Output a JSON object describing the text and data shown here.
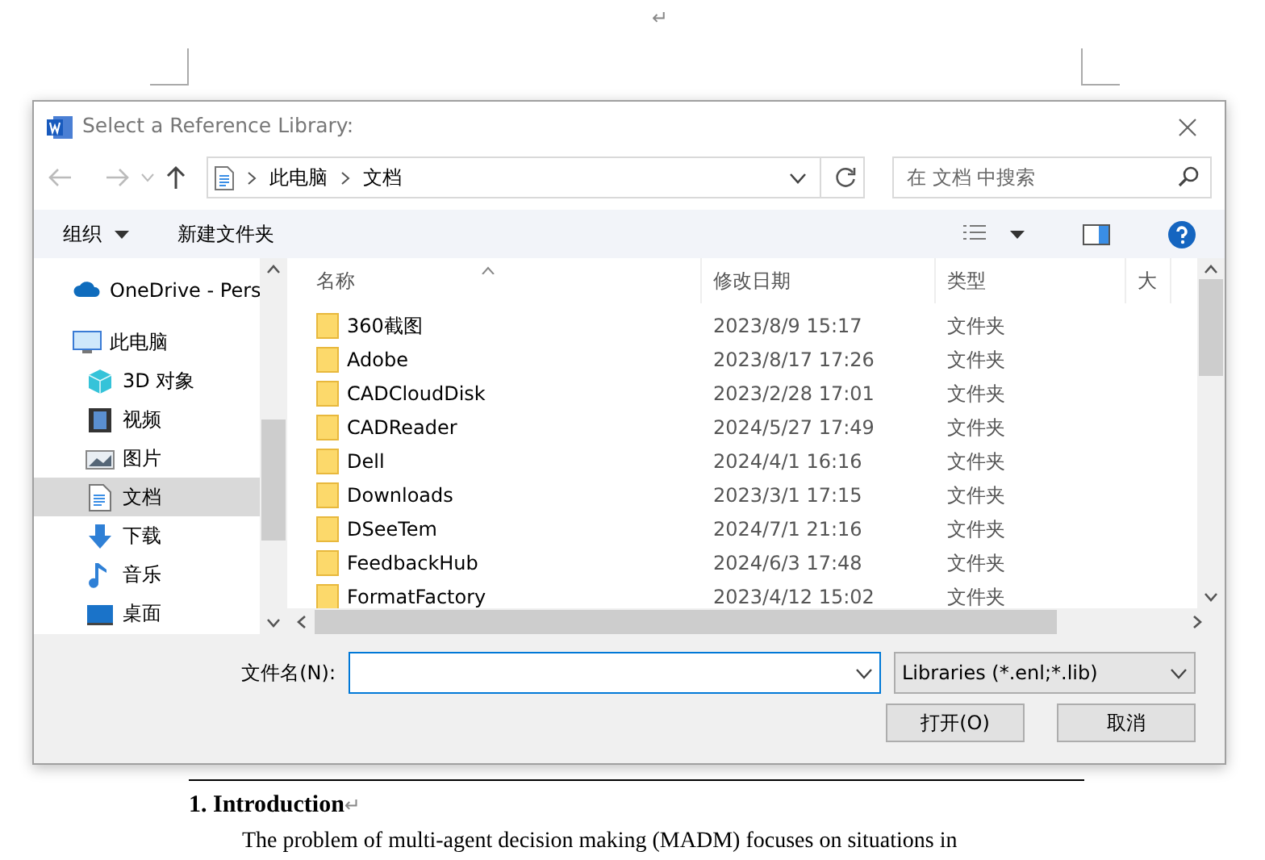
{
  "document": {
    "return_mark": "↵",
    "section_heading": "1. Introduction",
    "section_mark": "↵",
    "paragraph": "The problem of multi-agent decision making (MADM) focuses on situations in"
  },
  "dialog": {
    "title": "Select a Reference Library:",
    "breadcrumb": [
      "此电脑",
      "文档"
    ],
    "search": {
      "placeholder": "在 文档 中搜索"
    },
    "toolbar": {
      "organize": "组织",
      "new_folder": "新建文件夹"
    },
    "sidebar": [
      {
        "label": "OneDrive - Pers",
        "kind": "cloud",
        "selected": false
      },
      {
        "label": "此电脑",
        "kind": "computer",
        "selected": false,
        "children": [
          {
            "label": "3D 对象",
            "kind": "cube",
            "selected": false
          },
          {
            "label": "视频",
            "kind": "video",
            "selected": false
          },
          {
            "label": "图片",
            "kind": "picture",
            "selected": false
          },
          {
            "label": "文档",
            "kind": "document",
            "selected": true
          },
          {
            "label": "下载",
            "kind": "download",
            "selected": false
          },
          {
            "label": "音乐",
            "kind": "music",
            "selected": false
          },
          {
            "label": "桌面",
            "kind": "desktop",
            "selected": false
          }
        ]
      }
    ],
    "columns": [
      "名称",
      "修改日期",
      "类型",
      "大"
    ],
    "rows": [
      {
        "name": "360截图",
        "modified": "2023/8/9 15:17",
        "type": "文件夹"
      },
      {
        "name": "Adobe",
        "modified": "2023/8/17 17:26",
        "type": "文件夹"
      },
      {
        "name": "CADCloudDisk",
        "modified": "2023/2/28 17:01",
        "type": "文件夹"
      },
      {
        "name": "CADReader",
        "modified": "2024/5/27 17:49",
        "type": "文件夹"
      },
      {
        "name": "Dell",
        "modified": "2024/4/1 16:16",
        "type": "文件夹"
      },
      {
        "name": "Downloads",
        "modified": "2023/3/1 17:15",
        "type": "文件夹"
      },
      {
        "name": "DSeeTem",
        "modified": "2024/7/1 21:16",
        "type": "文件夹"
      },
      {
        "name": "FeedbackHub",
        "modified": "2024/6/3 17:48",
        "type": "文件夹"
      },
      {
        "name": "FormatFactory",
        "modified": "2023/4/12 15:02",
        "type": "文件夹"
      }
    ],
    "filename_label": "文件名(N):",
    "filter": "Libraries (*.enl;*.lib)",
    "buttons": {
      "open": "打开(O)",
      "cancel": "取消"
    }
  }
}
